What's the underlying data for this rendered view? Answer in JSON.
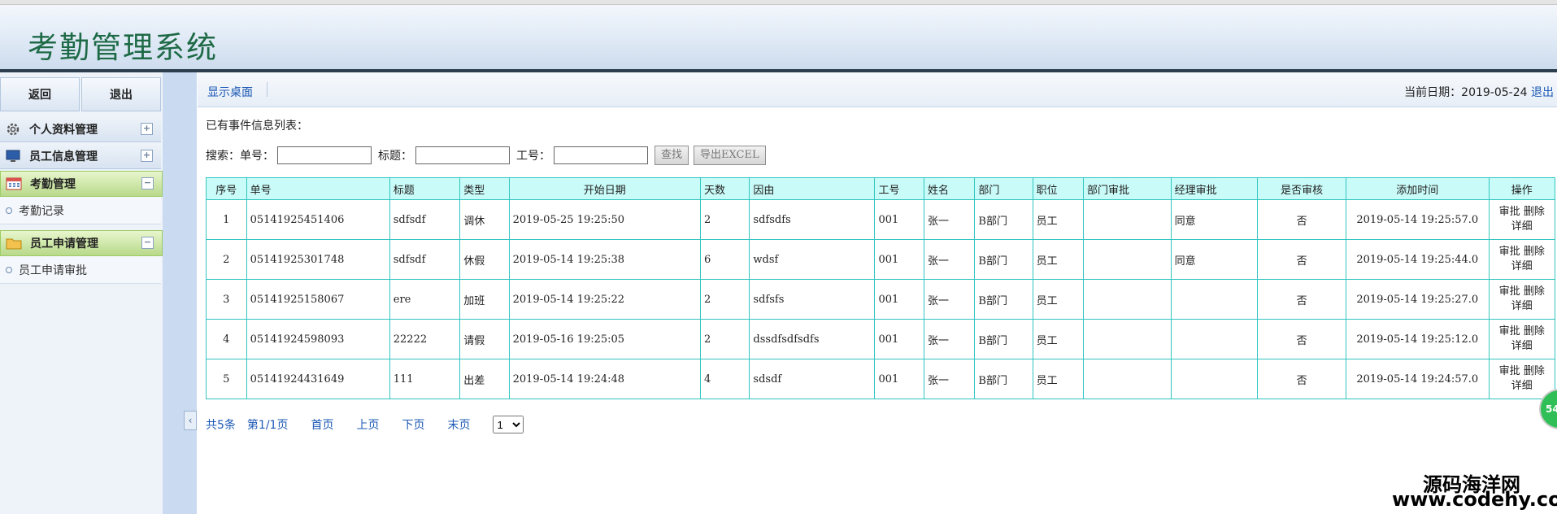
{
  "header": {
    "title": "考勤管理系统"
  },
  "sidebar": {
    "back_label": "返回",
    "logout_label": "退出",
    "menus": [
      {
        "label": "个人资料管理",
        "icon": "gear-icon",
        "toggle": "+"
      },
      {
        "label": "员工信息管理",
        "icon": "monitor-icon",
        "toggle": "+"
      },
      {
        "label": "考勤管理",
        "icon": "calendar-icon",
        "toggle": "−"
      },
      {
        "label": "员工申请管理",
        "icon": "folder-icon",
        "toggle": "−"
      }
    ],
    "subitems": {
      "attendance_record": "考勤记录",
      "apply_review": "员工申请审批"
    }
  },
  "topbar": {
    "desktop_link": "显示桌面",
    "date_label": "当前日期：",
    "date_value": "2019-05-24",
    "logout_link": "退出"
  },
  "list": {
    "title": "已有事件信息列表：",
    "search": {
      "label": "搜索：",
      "order_label": "单号：",
      "subject_label": "标题：",
      "empno_label": "工号：",
      "search_button": "查找",
      "export_button": "导出EXCEL"
    },
    "columns": [
      "序号",
      "单号",
      "标题",
      "类型",
      "开始日期",
      "天数",
      "因由",
      "工号",
      "姓名",
      "部门",
      "职位",
      "部门审批",
      "经理审批",
      "是否审核",
      "添加时间",
      "操作"
    ],
    "rows": [
      {
        "seq": "1",
        "order": "05141925451406",
        "subject": "sdfsdf",
        "type": "调休",
        "start": "2019-05-25 19:25:50",
        "days": "2",
        "reason": "sdfsdfs",
        "empno": "001",
        "name": "张一",
        "dept": "B部门",
        "position": "员工",
        "dept_approval": "",
        "mgr_approval": "同意",
        "reviewed": "否",
        "added": "2019-05-14 19:25:57.0"
      },
      {
        "seq": "2",
        "order": "05141925301748",
        "subject": "sdfsdf",
        "type": "休假",
        "start": "2019-05-14 19:25:38",
        "days": "6",
        "reason": "wdsf",
        "empno": "001",
        "name": "张一",
        "dept": "B部门",
        "position": "员工",
        "dept_approval": "",
        "mgr_approval": "同意",
        "reviewed": "否",
        "added": "2019-05-14 19:25:44.0"
      },
      {
        "seq": "3",
        "order": "05141925158067",
        "subject": "ere",
        "type": "加班",
        "start": "2019-05-14 19:25:22",
        "days": "2",
        "reason": "sdfsfs",
        "empno": "001",
        "name": "张一",
        "dept": "B部门",
        "position": "员工",
        "dept_approval": "",
        "mgr_approval": "",
        "reviewed": "否",
        "added": "2019-05-14 19:25:27.0"
      },
      {
        "seq": "4",
        "order": "05141924598093",
        "subject": "22222",
        "type": "请假",
        "start": "2019-05-16 19:25:05",
        "days": "2",
        "reason": "dssdfsdfsdfs",
        "empno": "001",
        "name": "张一",
        "dept": "B部门",
        "position": "员工",
        "dept_approval": "",
        "mgr_approval": "",
        "reviewed": "否",
        "added": "2019-05-14 19:25:12.0"
      },
      {
        "seq": "5",
        "order": "05141924431649",
        "subject": "111",
        "type": "出差",
        "start": "2019-05-14 19:24:48",
        "days": "4",
        "reason": "sdsdf",
        "empno": "001",
        "name": "张一",
        "dept": "B部门",
        "position": "员工",
        "dept_approval": "",
        "mgr_approval": "",
        "reviewed": "否",
        "added": "2019-05-14 19:24:57.0"
      }
    ],
    "row_actions": {
      "approve": "审批",
      "delete": "删除",
      "detail": "详细"
    }
  },
  "pager": {
    "total": "共5条",
    "page_info": "第1/1页",
    "first": "首页",
    "prev": "上页",
    "next": "下页",
    "last": "末页",
    "page_select": "1"
  },
  "overlay": {
    "float_badge": "54",
    "watermark_line1": "源码海洋网",
    "watermark_line2": "www.codehy.com"
  }
}
